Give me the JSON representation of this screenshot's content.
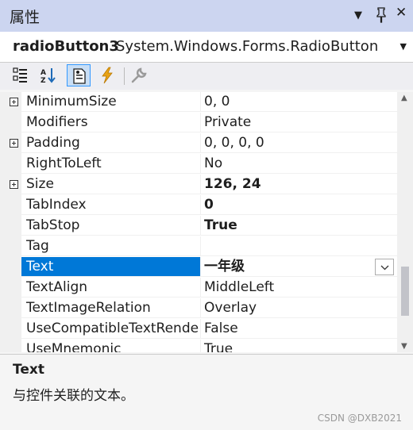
{
  "window": {
    "title": "属性",
    "icons": [
      "dropdown-arrow-icon",
      "pin-icon",
      "close-icon"
    ],
    "glyphs": {
      "dropdown": "▼",
      "pin": "📌",
      "close": "✕"
    }
  },
  "object": {
    "name": "radioButton3",
    "type": "System.Windows.Forms.RadioButton",
    "arrow": "▼"
  },
  "toolbar": {
    "buttons": [
      "categorized-icon",
      "alphabetical-icon",
      "properties-icon",
      "events-icon",
      "property-pages-icon"
    ],
    "active": "properties-icon"
  },
  "properties": [
    {
      "name": "MinimumSize",
      "value": "0, 0",
      "expandable": true,
      "bold": false
    },
    {
      "name": "Modifiers",
      "value": "Private",
      "expandable": false,
      "bold": false
    },
    {
      "name": "Padding",
      "value": "0, 0, 0, 0",
      "expandable": true,
      "bold": false
    },
    {
      "name": "RightToLeft",
      "value": "No",
      "expandable": false,
      "bold": false
    },
    {
      "name": "Size",
      "value": "126, 24",
      "expandable": true,
      "bold": true
    },
    {
      "name": "TabIndex",
      "value": "0",
      "expandable": false,
      "bold": true
    },
    {
      "name": "TabStop",
      "value": "True",
      "expandable": false,
      "bold": true
    },
    {
      "name": "Tag",
      "value": "",
      "expandable": false,
      "bold": false
    },
    {
      "name": "Text",
      "value": "一年级",
      "expandable": false,
      "bold": true,
      "selected": true
    },
    {
      "name": "TextAlign",
      "value": "MiddleLeft",
      "expandable": false,
      "bold": false
    },
    {
      "name": "TextImageRelation",
      "value": "Overlay",
      "expandable": false,
      "bold": false
    },
    {
      "name": "UseCompatibleTextRende",
      "value": "False",
      "expandable": false,
      "bold": false
    },
    {
      "name": "UseMnemonic",
      "value": "True",
      "expandable": false,
      "bold": false
    }
  ],
  "scrollbar": {
    "up": "▲",
    "down": "▼",
    "position": 0.72
  },
  "description": {
    "title": "Text",
    "text": "与控件关联的文本。"
  },
  "watermark": "CSDN @DXB2021",
  "colors": {
    "titlebar": "#ccd5f0",
    "selection": "#0078d7",
    "toolbar_active": "#c9def5",
    "events_icon": "#e8a317"
  }
}
